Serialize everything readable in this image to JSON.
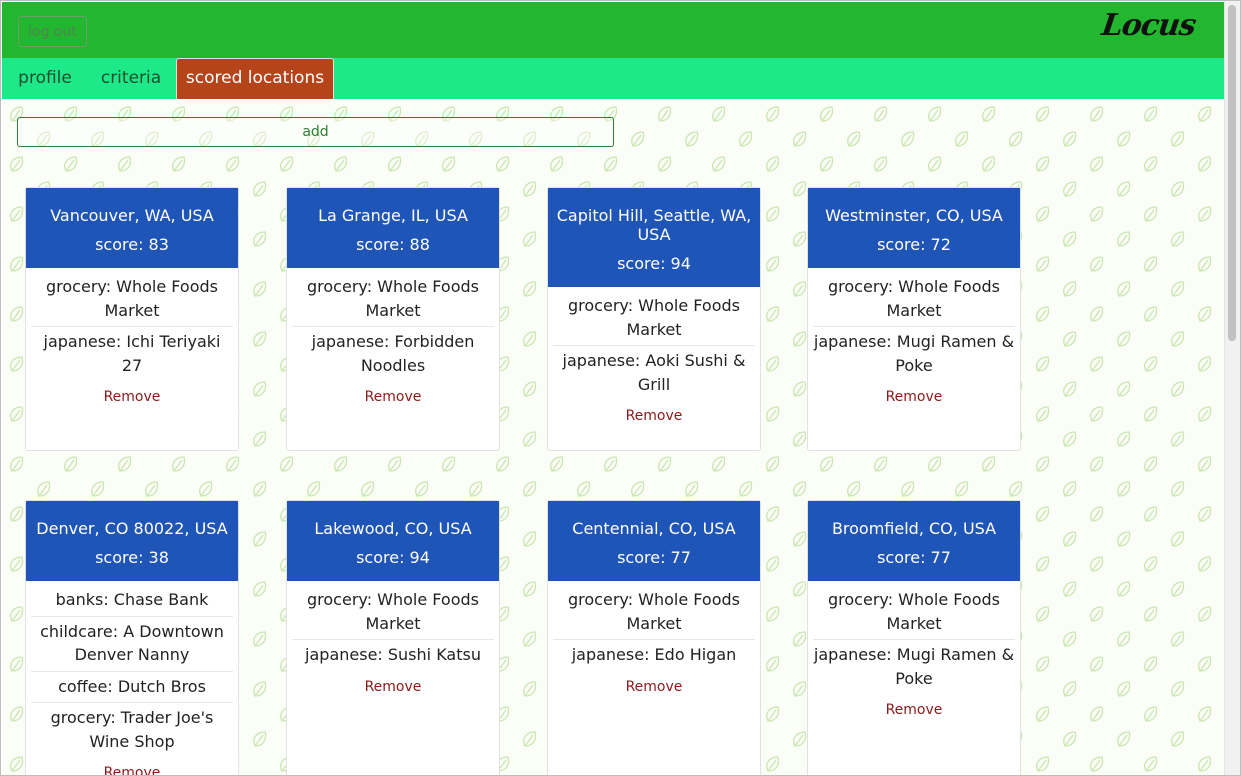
{
  "header": {
    "logout_label": "log out",
    "logo": "Locus"
  },
  "tabs": [
    {
      "label": "profile"
    },
    {
      "label": "criteria"
    },
    {
      "label": "scored locations",
      "active": true
    }
  ],
  "add_label": "add",
  "remove_label": "Remove",
  "colors": {
    "topbar": "#22b72f",
    "tabbar": "#1ee988",
    "active_tab": "#b5441a",
    "card_header": "#2055b8",
    "remove_link": "#8b1a1a"
  },
  "locations": [
    {
      "name": "Vancouver, WA, USA",
      "score": "score: 83",
      "items": [
        "grocery: Whole Foods Market",
        "japanese: Ichi Teriyaki 27"
      ]
    },
    {
      "name": "La Grange, IL, USA",
      "score": "score: 88",
      "items": [
        "grocery: Whole Foods Market",
        "japanese: Forbidden Noodles"
      ]
    },
    {
      "name": "Capitol Hill, Seattle, WA, USA",
      "score": "score: 94",
      "items": [
        "grocery: Whole Foods Market",
        "japanese: Aoki Sushi & Grill"
      ]
    },
    {
      "name": "Westminster, CO, USA",
      "score": "score: 72",
      "items": [
        "grocery: Whole Foods Market",
        "japanese: Mugi Ramen & Poke"
      ]
    },
    {
      "name": "Denver, CO 80022, USA",
      "score": "score: 38",
      "items": [
        "banks: Chase Bank",
        "childcare: A Downtown Denver Nanny",
        "coffee: Dutch Bros",
        "grocery: Trader Joe's Wine Shop"
      ]
    },
    {
      "name": "Lakewood, CO, USA",
      "score": "score: 94",
      "items": [
        "grocery: Whole Foods Market",
        "japanese: Sushi Katsu"
      ]
    },
    {
      "name": "Centennial, CO, USA",
      "score": "score: 77",
      "items": [
        "grocery: Whole Foods Market",
        "japanese: Edo Higan"
      ]
    },
    {
      "name": "Broomfield, CO, USA",
      "score": "score: 77",
      "items": [
        "grocery: Whole Foods Market",
        "japanese: Mugi Ramen & Poke"
      ]
    }
  ]
}
